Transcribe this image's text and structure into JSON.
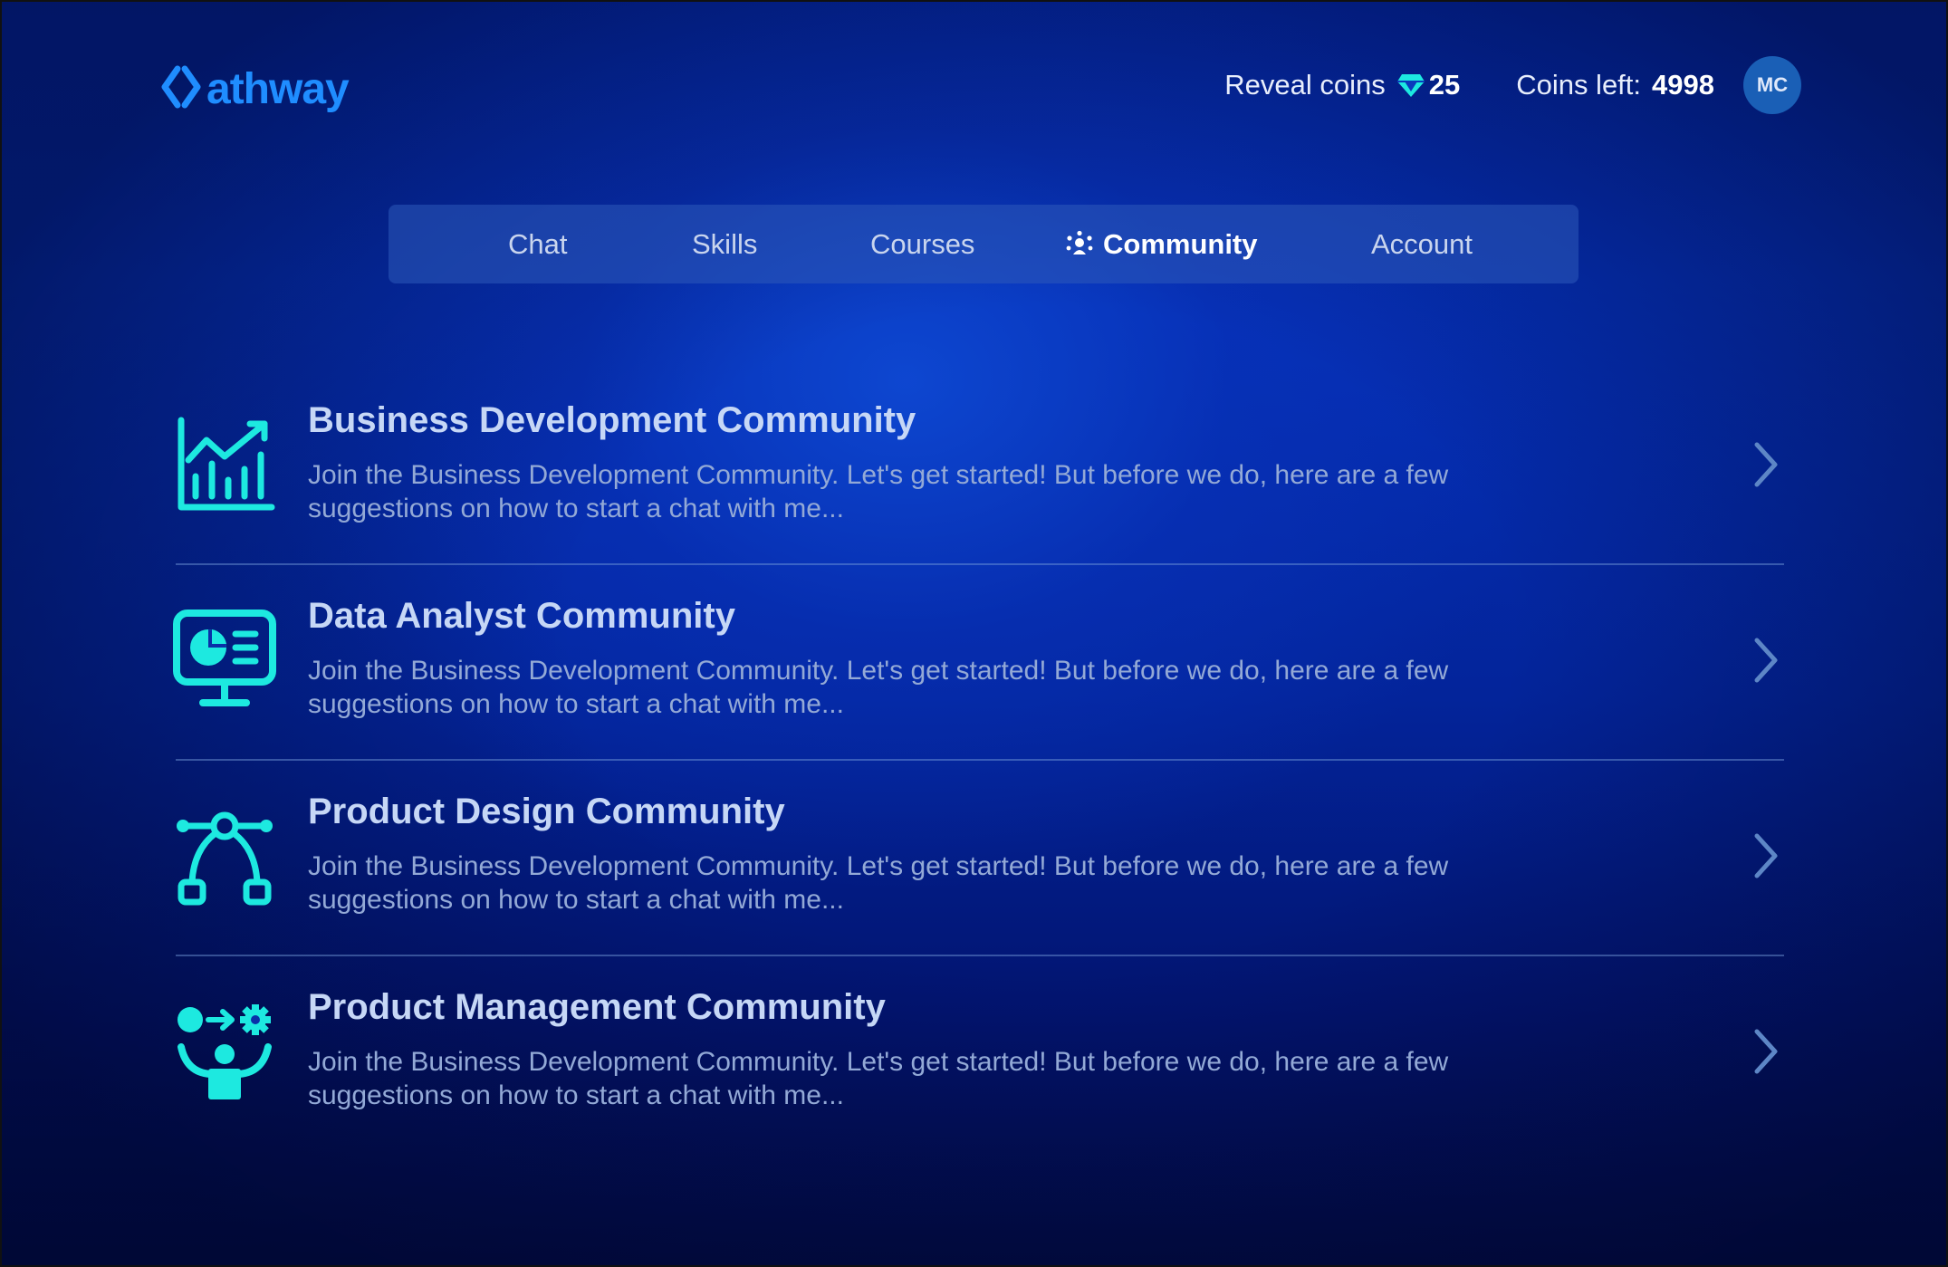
{
  "app": {
    "logo_text": "athway",
    "brand_color": "#1f8dff",
    "accent_color": "#1de9e0"
  },
  "header": {
    "reveal_label": "Reveal coins",
    "reveal_icon": "gem-icon",
    "reveal_value": "25",
    "coins_label": "Coins left:",
    "coins_value": "4998",
    "avatar_initials": "MC"
  },
  "nav": {
    "tabs": [
      {
        "label": "Chat",
        "active": false
      },
      {
        "label": "Skills",
        "active": false
      },
      {
        "label": "Courses",
        "active": false
      },
      {
        "label": "Community",
        "active": true,
        "icon": "community-icon"
      },
      {
        "label": "Account",
        "active": false
      }
    ]
  },
  "communities": [
    {
      "title": "Business Development Community",
      "description": "Join the Business Development Community. Let's get started! But before we do, here are a few suggestions on how to start a chat with me...",
      "icon": "growth-chart-icon"
    },
    {
      "title": "Data Analyst Community",
      "description": "Join the Business Development Community. Let's get started! But before we do, here are a few suggestions on how to start a chat with me...",
      "icon": "analytics-monitor-icon"
    },
    {
      "title": "Product Design Community",
      "description": "Join the Business Development Community. Let's get started! But before we do, here are a few suggestions on how to start a chat with me...",
      "icon": "vector-pen-icon"
    },
    {
      "title": "Product Management Community",
      "description": "Join the Business Development Community. Let's get started! But before we do, here are a few suggestions on how to start a chat with me...",
      "icon": "process-management-icon"
    }
  ]
}
